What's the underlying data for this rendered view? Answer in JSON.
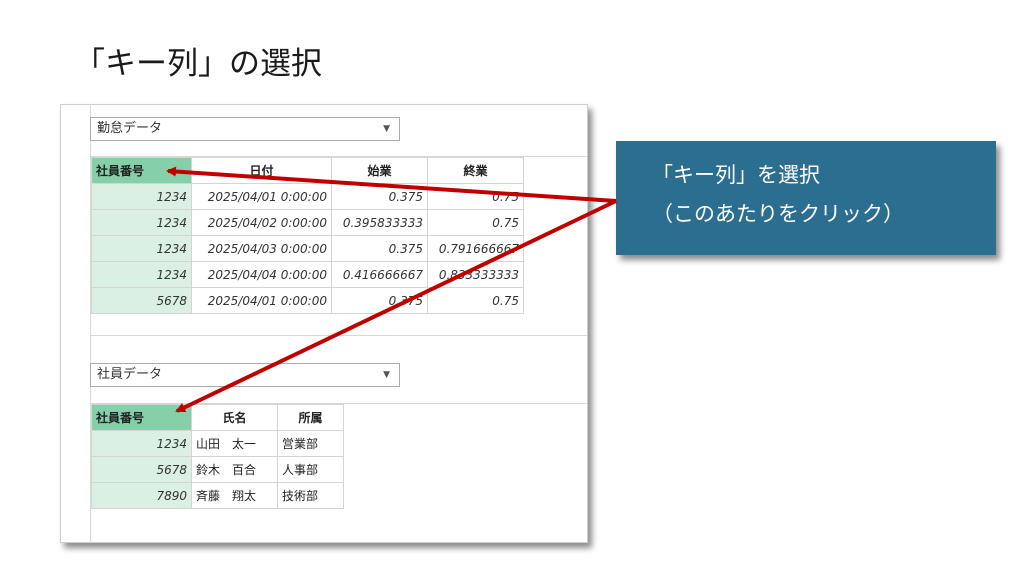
{
  "slide": {
    "title": "「キー列」の選択"
  },
  "table1": {
    "query_name": "勤怠データ",
    "columns": [
      "社員番号",
      "日付",
      "始業",
      "終業"
    ],
    "rows": [
      [
        "1234",
        "2025/04/01 0:00:00",
        "0.375",
        "0.75"
      ],
      [
        "1234",
        "2025/04/02 0:00:00",
        "0.395833333",
        "0.75"
      ],
      [
        "1234",
        "2025/04/03 0:00:00",
        "0.375",
        "0.791666667"
      ],
      [
        "1234",
        "2025/04/04 0:00:00",
        "0.416666667",
        "0.833333333"
      ],
      [
        "5678",
        "2025/04/01 0:00:00",
        "0.375",
        "0.75"
      ]
    ]
  },
  "table2": {
    "query_name": "社員データ",
    "columns": [
      "社員番号",
      "氏名",
      "所属"
    ],
    "rows": [
      [
        "1234",
        "山田　太一",
        "営業部"
      ],
      [
        "5678",
        "鈴木　百合",
        "人事部"
      ],
      [
        "7890",
        "斉藤　翔太",
        "技術部"
      ]
    ]
  },
  "callout": {
    "line1": "「キー列」を選択",
    "line2": "（このあたりをクリック）"
  },
  "colors": {
    "key_header": "#85cfa9",
    "key_cell": "#d9f0e3",
    "callout_bg": "#2c6e8f",
    "arrow": "#c00000"
  },
  "icons": {
    "dropdown": "chevron-down-icon"
  }
}
